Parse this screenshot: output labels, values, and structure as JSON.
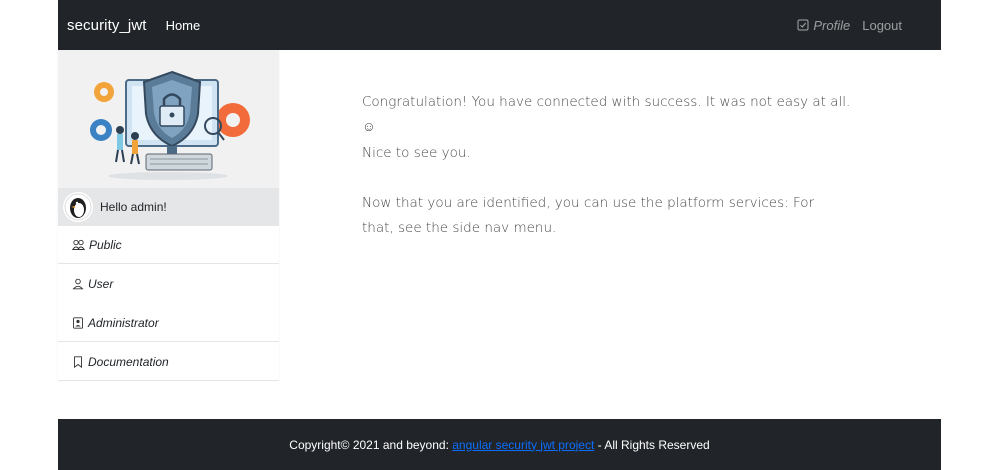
{
  "navbar": {
    "brand": "security_jwt",
    "home_label": "Home",
    "profile_label": "Profile",
    "logout_label": "Logout"
  },
  "sidebar": {
    "greeting": "Hello admin!",
    "items": [
      {
        "label": "Public",
        "icon": "people-icon"
      },
      {
        "label": "User",
        "icon": "person-icon"
      },
      {
        "label": "Administrator",
        "icon": "badge-icon"
      },
      {
        "label": "Documentation",
        "icon": "bookmark-icon"
      }
    ]
  },
  "main": {
    "line1": "Congratulation! You have connected with success. It was not easy at all. ☺",
    "line2": "Nice to see you.",
    "line3": "Now that you are identified, you can use the platform services: For that, see the side nav menu."
  },
  "footer": {
    "prefix": "Copyright© 2021 and beyond: ",
    "link_text": "angular security jwt project",
    "suffix": " - All Rights Reserved"
  },
  "colors": {
    "navbar_bg": "#212529",
    "link": "#0d6efd",
    "greeting_bg": "#e4e6e8"
  }
}
